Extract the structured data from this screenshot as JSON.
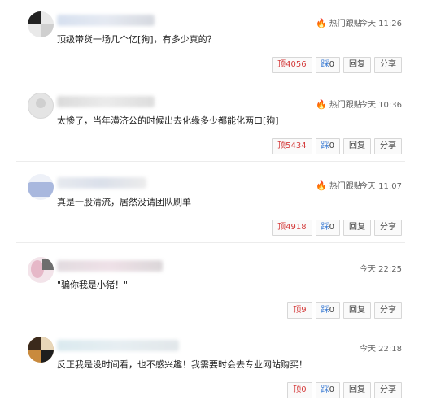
{
  "comments": [
    {
      "hot_label": "热门跟贴",
      "time": "今天 11:26",
      "text": "顶级带货一场几个亿[狗]，有多少真的？",
      "up_icon": "顶",
      "up_count": "4056",
      "down_icon": "踩",
      "down_count": "0",
      "reply_label": "回复",
      "share_label": "分享"
    },
    {
      "hot_label": "热门跟贴",
      "time": "今天 10:36",
      "text": "太惨了，当年潢济公的时候出去化缘多少都能化两口[狗]",
      "up_icon": "顶",
      "up_count": "5434",
      "down_icon": "踩",
      "down_count": "0",
      "reply_label": "回复",
      "share_label": "分享"
    },
    {
      "hot_label": "热门跟贴",
      "time": "今天 11:07",
      "text": "真是一股清流，居然没请团队刷单",
      "up_icon": "顶",
      "up_count": "4918",
      "down_icon": "踩",
      "down_count": "0",
      "reply_label": "回复",
      "share_label": "分享"
    },
    {
      "time": "今天 22:25",
      "text": "\"骗你我是小猪！\"",
      "up_icon": "顶",
      "up_count": "9",
      "down_icon": "踩",
      "down_count": "0",
      "reply_label": "回复",
      "share_label": "分享"
    },
    {
      "time": "今天 22:18",
      "text": "反正我是没时间看，也不感兴趣！我需要时会去专业网站购买！",
      "up_icon": "顶",
      "up_count": "0",
      "down_icon": "踩",
      "down_count": "0",
      "reply_label": "回复",
      "share_label": "分享"
    }
  ],
  "icons": {
    "hot": "flame-icon",
    "up": "thumb-up-icon",
    "down": "thumb-down-icon"
  },
  "colors": {
    "up": "#d43a3a",
    "hot": "#e8453c",
    "down": "#3a7bd4",
    "border": "#d7d7d7"
  }
}
